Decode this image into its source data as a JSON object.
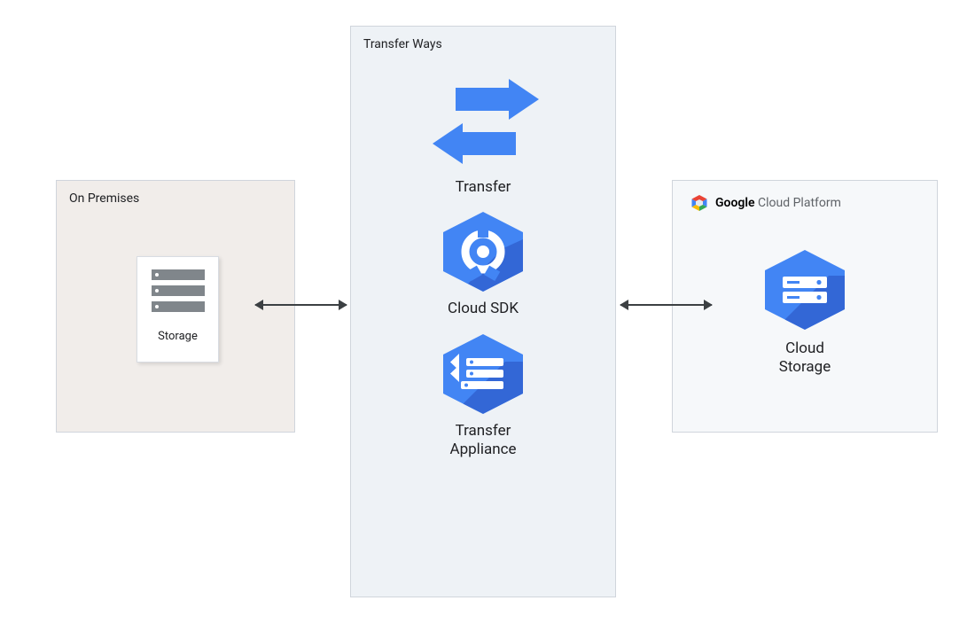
{
  "onprem": {
    "title": "On Premises",
    "storage_label": "Storage"
  },
  "transfer": {
    "title": "Transfer Ways",
    "items": [
      {
        "label": "Transfer"
      },
      {
        "label": "Cloud SDK"
      },
      {
        "label": "Transfer\nAppliance"
      }
    ]
  },
  "gcp": {
    "brand_bold": "Google",
    "brand_rest": "Cloud Platform",
    "storage_label": "Cloud\nStorage"
  },
  "colors": {
    "hex_blue": "#4285f4",
    "hex_blue_dark": "#3367d6"
  }
}
